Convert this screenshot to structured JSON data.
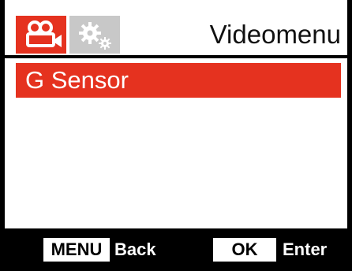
{
  "header": {
    "title": "Videomenu",
    "tabs": [
      {
        "icon": "video-camera-icon",
        "active": true
      },
      {
        "icon": "gears-icon",
        "active": false
      }
    ]
  },
  "menu": {
    "items": [
      {
        "label": "G Sensor",
        "selected": true
      }
    ]
  },
  "footer": {
    "menu_key": "MENU",
    "menu_action": "Back",
    "ok_key": "OK",
    "ok_action": "Enter"
  },
  "colors": {
    "accent": "#e5321f",
    "inactive_tab": "#c8c8c8",
    "footer_bg": "#000000"
  }
}
